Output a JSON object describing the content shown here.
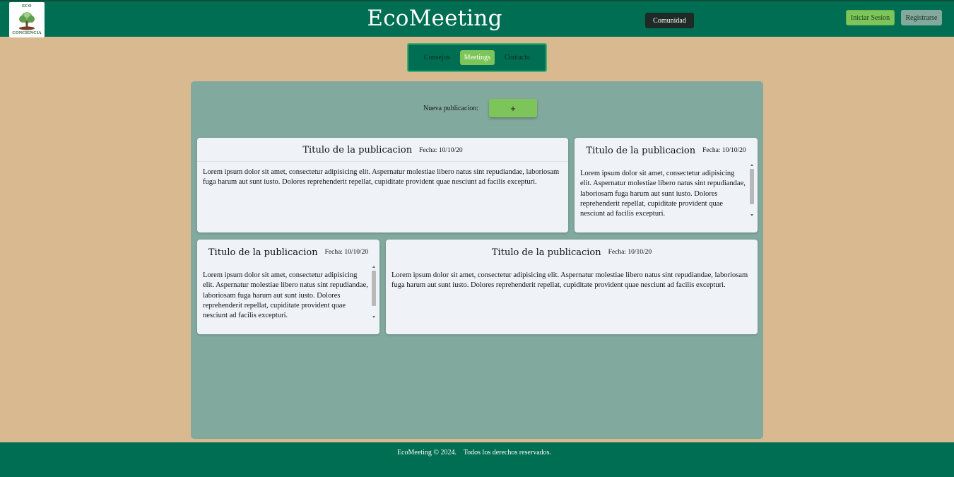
{
  "header": {
    "logo_top": "ECO",
    "logo_bottom": "CONCIENCIA",
    "title": "EcoMeeting",
    "community_label": "Comunidad",
    "login_label": "Iniciar Sesion",
    "register_label": "Registrarse"
  },
  "nav": {
    "items": [
      {
        "label": "Consejos",
        "active": false
      },
      {
        "label": "Meetings",
        "active": true
      },
      {
        "label": "Contacto",
        "active": false
      }
    ]
  },
  "main": {
    "new_post_label": "Nueva publicacion:",
    "new_post_button": "+",
    "posts": [
      {
        "title": "Titulo de la publicacion",
        "date": "Fecha: 10/10/20",
        "body": "Lorem ipsum dolor sit amet, consectetur adipisicing elit. Aspernatur molestiae libero natus sint repudiandae, laboriosam fuga harum aut sunt iusto. Dolores reprehenderit repellat, cupiditate provident quae nesciunt ad facilis excepturi."
      },
      {
        "title": "Titulo de la publicacion",
        "date": "Fecha: 10/10/20",
        "body": "Lorem ipsum dolor sit amet, consectetur adipisicing elit. Aspernatur molestiae libero natus sint repudiandae, laboriosam fuga harum aut sunt iusto. Dolores reprehenderit repellat, cupiditate provident quae nesciunt ad facilis excepturi."
      },
      {
        "title": "Titulo de la publicacion",
        "date": "Fecha: 10/10/20",
        "body": "Lorem ipsum dolor sit amet, consectetur adipisicing elit. Aspernatur molestiae libero natus sint repudiandae, laboriosam fuga harum aut sunt iusto. Dolores reprehenderit repellat, cupiditate provident quae nesciunt ad facilis excepturi."
      },
      {
        "title": "Titulo de la publicacion",
        "date": "Fecha: 10/10/20",
        "body": "Lorem ipsum dolor sit amet, consectetur adipisicing elit. Aspernatur molestiae libero natus sint repudiandae, laboriosam fuga harum aut sunt iusto. Dolores reprehenderit repellat, cupiditate provident quae nesciunt ad facilis excepturi."
      }
    ]
  },
  "footer": {
    "text": "EcoMeeting © 2024.    Todos los derechos reservados."
  },
  "colors": {
    "header_bg": "#006e52",
    "page_bg": "#d8b990",
    "panel_bg": "#82a99d",
    "accent_green": "#7dc55a",
    "card_bg": "#eff3f7"
  }
}
